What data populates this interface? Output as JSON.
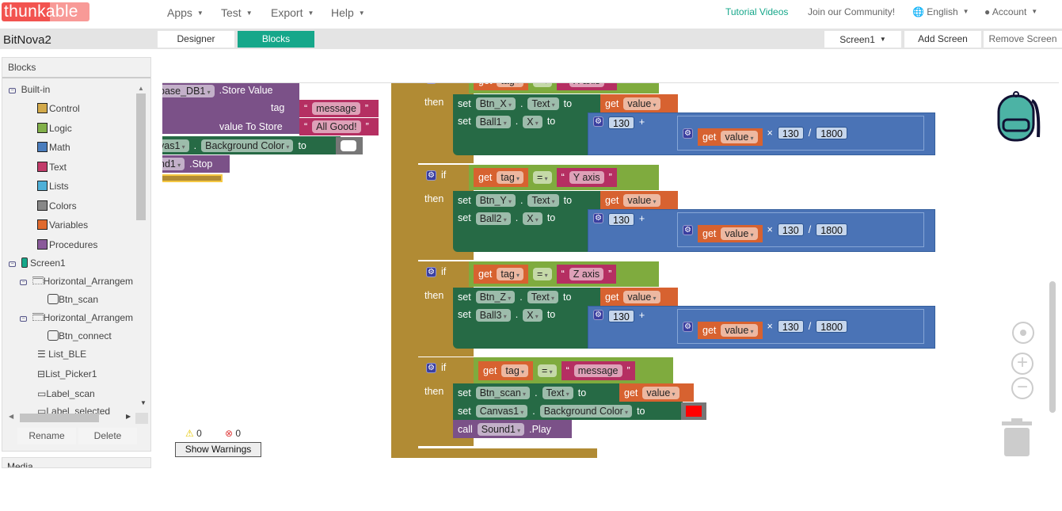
{
  "nav": {
    "logo": "thunkable",
    "menus": [
      "Apps",
      "Test",
      "Export",
      "Help"
    ],
    "tutorial": "Tutorial Videos",
    "community": "Join our Community!",
    "language": "English",
    "account": "Account",
    "accent": "#16a78a"
  },
  "project": {
    "name": "BitNova2",
    "tabs": [
      "Designer",
      "Blocks"
    ],
    "active_tab": "Blocks",
    "screen": "Screen1",
    "add_screen": "Add Screen",
    "remove_screen": "Remove Screen"
  },
  "panel": {
    "title": "Blocks",
    "builtin": "Built-in",
    "categories": [
      {
        "label": "Control",
        "color": "#d2a94a"
      },
      {
        "label": "Logic",
        "color": "#82b04a"
      },
      {
        "label": "Math",
        "color": "#4a7dbd"
      },
      {
        "label": "Text",
        "color": "#c23b6a"
      },
      {
        "label": "Lists",
        "color": "#4fb0d8"
      },
      {
        "label": "Colors",
        "color": "#888888"
      },
      {
        "label": "Variables",
        "color": "#e06a2e"
      },
      {
        "label": "Procedures",
        "color": "#8a5a9a"
      }
    ],
    "components": [
      "Screen1",
      "Horizontal_Arrangem",
      "Btn_scan",
      "Horizontal_Arrangem",
      "Btn_connect",
      "List_BLE",
      "List_Picker1",
      "Label_scan",
      "Label_selected"
    ],
    "rename": "Rename",
    "delete": "Delete",
    "media": "Media"
  },
  "warnings": {
    "warn_count": "0",
    "error_count": "0",
    "show": "Show Warnings"
  },
  "top": {
    "component": "base_DB1",
    "method": ".Store Value",
    "tag_label": "tag",
    "tag_value": "message",
    "value_label": "value To Store",
    "value": "All Good!",
    "set_comp": "vas1",
    "set_prop": "Background Color",
    "to": "to",
    "color": "#ffffff",
    "sound": "nd1",
    "stop": ".Stop"
  },
  "kw": {
    "if": "if",
    "then": "then",
    "set": "set",
    "to": "to",
    "get": "get",
    "call": "call",
    "dot": ".",
    "plus": "+",
    "times": "×",
    "div": "/",
    "eq": "=",
    "q1": "“",
    "q2": "”"
  },
  "sections": [
    {
      "var": "tag",
      "text": "X axis",
      "btn": "Btn_X",
      "prop": "Text",
      "val": "value",
      "ball": "Ball1",
      "axis": "X",
      "a": "130",
      "b": "130",
      "c": "1800"
    },
    {
      "var": "tag",
      "text": "Y axis",
      "btn": "Btn_Y",
      "prop": "Text",
      "val": "value",
      "ball": "Ball2",
      "axis": "X",
      "a": "130",
      "b": "130",
      "c": "1800"
    },
    {
      "var": "tag",
      "text": "Z axis",
      "btn": "Btn_Z",
      "prop": "Text",
      "val": "value",
      "ball": "Ball3",
      "axis": "X",
      "a": "130",
      "b": "130",
      "c": "1800"
    }
  ],
  "last": {
    "var": "tag",
    "text": "message",
    "btn": "Btn_scan",
    "prop": "Text",
    "val": "value",
    "canvas": "Canvas1",
    "cprop": "Background Color",
    "color": "#ff0000",
    "sound": "Sound1",
    "play": ".Play"
  }
}
